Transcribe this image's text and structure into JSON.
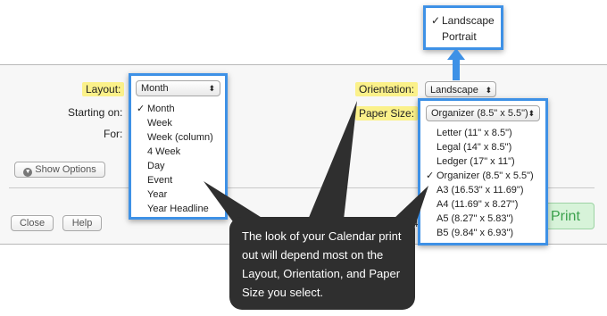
{
  "dialog": {
    "layout_label": "Layout:",
    "layout_value": "Month",
    "starting_on_label": "Starting on:",
    "for_label": "For:",
    "orientation_label": "Orientation:",
    "orientation_value": "Landscape",
    "paper_size_label": "Paper Size:",
    "paper_size_value": "Organizer (8.5\" x 5.5\")",
    "show_options_label": "Show Options",
    "close_label": "Close",
    "help_label": "Help",
    "print_label": "Print",
    "hidden_char": "4"
  },
  "layout_menu": {
    "items": [
      {
        "label": "Month",
        "checked": true
      },
      {
        "label": "Week",
        "checked": false
      },
      {
        "label": "Week (column)",
        "checked": false
      },
      {
        "label": "4 Week",
        "checked": false
      },
      {
        "label": "Day",
        "checked": false
      },
      {
        "label": "Event",
        "checked": false
      },
      {
        "label": "Year",
        "checked": false
      },
      {
        "label": "Year Headline",
        "checked": false
      }
    ]
  },
  "orientation_menu": {
    "items": [
      {
        "label": "Landscape",
        "checked": true
      },
      {
        "label": "Portrait",
        "checked": false
      }
    ]
  },
  "paper_menu": {
    "items": [
      {
        "label": "Letter (11\" x 8.5\")",
        "checked": false
      },
      {
        "label": "Legal (14\" x 8.5\")",
        "checked": false
      },
      {
        "label": "Ledger (17\" x 11\")",
        "checked": false
      },
      {
        "label": "Organizer (8.5\" x 5.5\")",
        "checked": true
      },
      {
        "label": "A3 (16.53\" x 11.69\")",
        "checked": false
      },
      {
        "label": "A4 (11.69\" x 8.27\")",
        "checked": false
      },
      {
        "label": "A5 (8.27\" x 5.83\")",
        "checked": false
      },
      {
        "label": "B5 (9.84\" x 6.93\")",
        "checked": false
      }
    ]
  },
  "tooltip": {
    "text": "The look of your Calendar print out will depend most on the Layout, Orientation, and Paper Size you select."
  },
  "glyphs": {
    "check": "✓",
    "updown": "⬍"
  },
  "colors": {
    "menu_border": "#3e91e6",
    "highlight": "#fbf18a",
    "print_bg": "#d7f3d9",
    "print_text": "#3aa14c",
    "tooltip_bg": "#2f2f2f"
  }
}
